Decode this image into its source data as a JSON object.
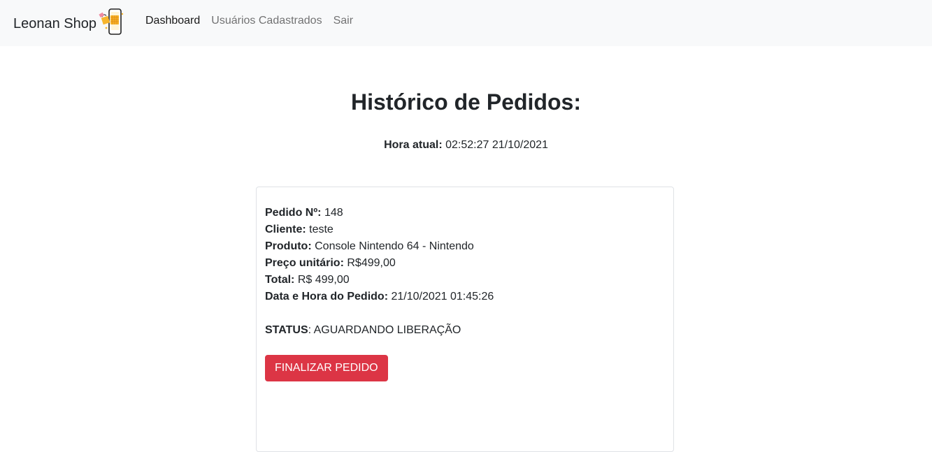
{
  "navbar": {
    "brand": "Leonan Shop",
    "logo_icon": "shopping-phone-logo-icon",
    "links": [
      {
        "label": "Dashboard",
        "active": true
      },
      {
        "label": "Usuários Cadastrados",
        "active": false
      },
      {
        "label": "Sair",
        "active": false
      }
    ]
  },
  "page": {
    "title": "Histórico de Pedidos:",
    "clock_label": "Hora atual:",
    "clock_value": "02:52:27 21/10/2021"
  },
  "order": {
    "number_label": "Pedido Nº:",
    "number_value": "148",
    "client_label": "Cliente:",
    "client_value": "teste",
    "product_label": "Produto:",
    "product_value": "Console Nintendo 64 - Nintendo",
    "unit_price_label": "Preço unitário:",
    "unit_price_value": "R$499,00",
    "total_label": "Total:",
    "total_value": "R$ 499,00",
    "datetime_label": "Data e Hora do Pedido:",
    "datetime_value": "21/10/2021 01:45:26",
    "status_label": "STATUS",
    "status_value": ": AGUARDANDO LIBERAÇÃO",
    "finish_button": "FINALIZAR PEDIDO"
  },
  "colors": {
    "navbar_bg": "#f8f9fa",
    "danger": "#dc3545",
    "text": "#212529",
    "logo_accent": "#f7b52c"
  }
}
